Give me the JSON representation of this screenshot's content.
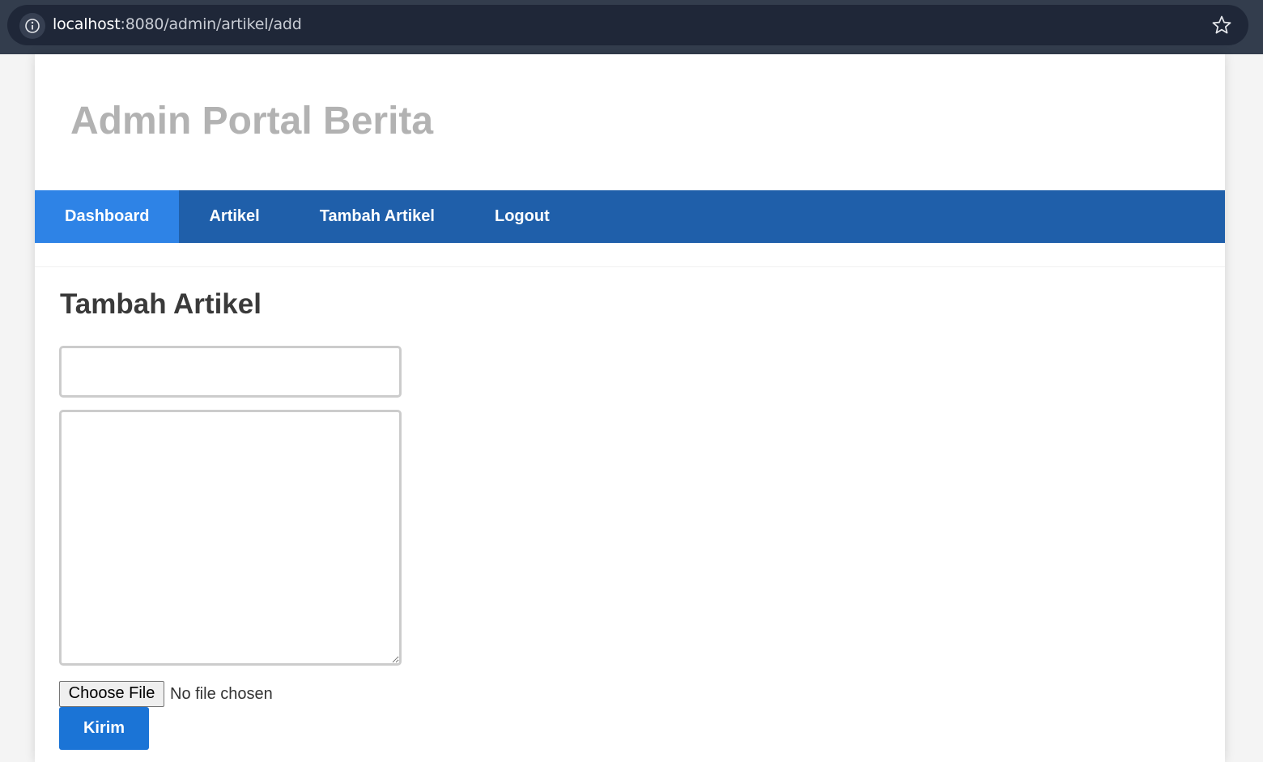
{
  "browser": {
    "url_host": "localhost",
    "url_path": ":8080/admin/artikel/add",
    "info_icon": "info-icon",
    "bookmark_icon": "star-icon"
  },
  "header": {
    "site_title": "Admin Portal Berita"
  },
  "nav": {
    "items": [
      {
        "label": "Dashboard",
        "active": true
      },
      {
        "label": "Artikel",
        "active": false
      },
      {
        "label": "Tambah Artikel",
        "active": false
      },
      {
        "label": "Logout",
        "active": false
      }
    ]
  },
  "main": {
    "title": "Tambah Artikel",
    "form": {
      "title_value": "",
      "content_value": "",
      "file_button_label": "Choose File",
      "file_status": "No file chosen",
      "submit_label": "Kirim"
    }
  },
  "colors": {
    "browser_chrome": "#333d4d",
    "url_pill": "#1f2738",
    "nav_background": "#1f5faa",
    "nav_active": "#2e83e6",
    "site_title": "#b2b2b2",
    "submit_button": "#1b74d6"
  }
}
